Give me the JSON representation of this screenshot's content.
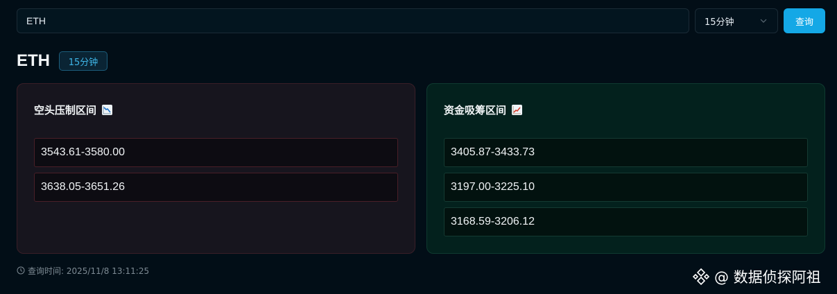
{
  "search": {
    "value": "ETH"
  },
  "interval_select": {
    "selected": "15分钟"
  },
  "query_button": {
    "label": "查询"
  },
  "title": {
    "symbol": "ETH",
    "interval_badge": "15分钟"
  },
  "short_panel": {
    "title": "空头压制区间",
    "icon": "chart-decreasing-icon",
    "ranges": [
      "3543.61-3580.00",
      "3638.05-3651.26"
    ]
  },
  "long_panel": {
    "title": "资金吸筹区间",
    "icon": "chart-increasing-icon",
    "ranges": [
      "3405.87-3433.73",
      "3197.00-3225.10",
      "3168.59-3206.12"
    ]
  },
  "footer": {
    "query_time": "查询时间: 2025/11/8 13:11:25"
  },
  "watermark": {
    "text": "@ 数据侦探阿祖"
  },
  "colors": {
    "accent": "#14a8e6",
    "short_border": "#4a1f28",
    "long_border": "#143a32"
  }
}
